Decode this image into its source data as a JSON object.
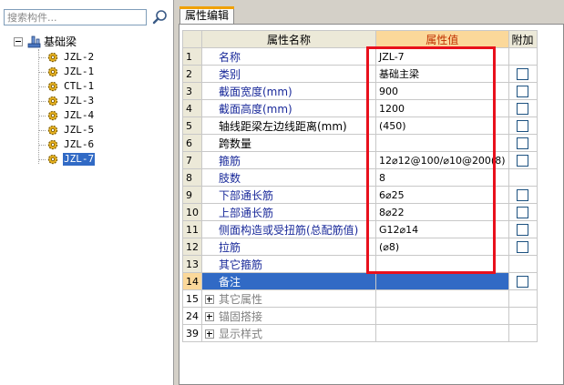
{
  "search": {
    "placeholder": "搜索构件..."
  },
  "tree": {
    "root_label": "基础梁",
    "items": [
      {
        "label": "JZL-2"
      },
      {
        "label": "JZL-1"
      },
      {
        "label": "CTL-1"
      },
      {
        "label": "JZL-3"
      },
      {
        "label": "JZL-4"
      },
      {
        "label": "JZL-5"
      },
      {
        "label": "JZL-6"
      },
      {
        "label": "JZL-7",
        "selected": true
      }
    ]
  },
  "tab": {
    "label": "属性编辑"
  },
  "grid": {
    "headers": {
      "name": "属性名称",
      "value": "属性值",
      "extra": "附加"
    },
    "rows": [
      {
        "num": "1",
        "name": "名称",
        "value": "JZL-7",
        "check": false
      },
      {
        "num": "2",
        "name": "类别",
        "value": "基础主梁",
        "check": true
      },
      {
        "num": "3",
        "name": "截面宽度(mm)",
        "value": "900",
        "check": true
      },
      {
        "num": "4",
        "name": "截面高度(mm)",
        "value": "1200",
        "check": true
      },
      {
        "num": "5",
        "name": "轴线距梁左边线距离(mm)",
        "value": "(450)",
        "check": true
      },
      {
        "num": "6",
        "name": "跨数量",
        "value": "",
        "check": true
      },
      {
        "num": "7",
        "name": "箍筋",
        "value": "12⌀12@100/⌀10@200(8)",
        "check": true
      },
      {
        "num": "8",
        "name": "肢数",
        "value": "8",
        "check": false
      },
      {
        "num": "9",
        "name": "下部通长筋",
        "value": "6⌀25",
        "check": true
      },
      {
        "num": "10",
        "name": "上部通长筋",
        "value": "8⌀22",
        "check": true
      },
      {
        "num": "11",
        "name": "侧面构造或受扭筋(总配筋值)",
        "value": "G12⌀14",
        "check": true
      },
      {
        "num": "12",
        "name": "拉筋",
        "value": "(⌀8)",
        "check": true
      },
      {
        "num": "13",
        "name": "其它箍筋",
        "value": "",
        "check": false
      },
      {
        "num": "14",
        "name": "备注",
        "value": "",
        "check": true,
        "selected": true
      }
    ],
    "groups": [
      {
        "num": "15",
        "name": "其它属性"
      },
      {
        "num": "24",
        "name": "锚固搭接"
      },
      {
        "num": "39",
        "name": "显示样式"
      }
    ]
  },
  "colors": {
    "highlight_box": "#e8101c",
    "selection": "#316ac5",
    "value_header": "#fbd89a"
  }
}
